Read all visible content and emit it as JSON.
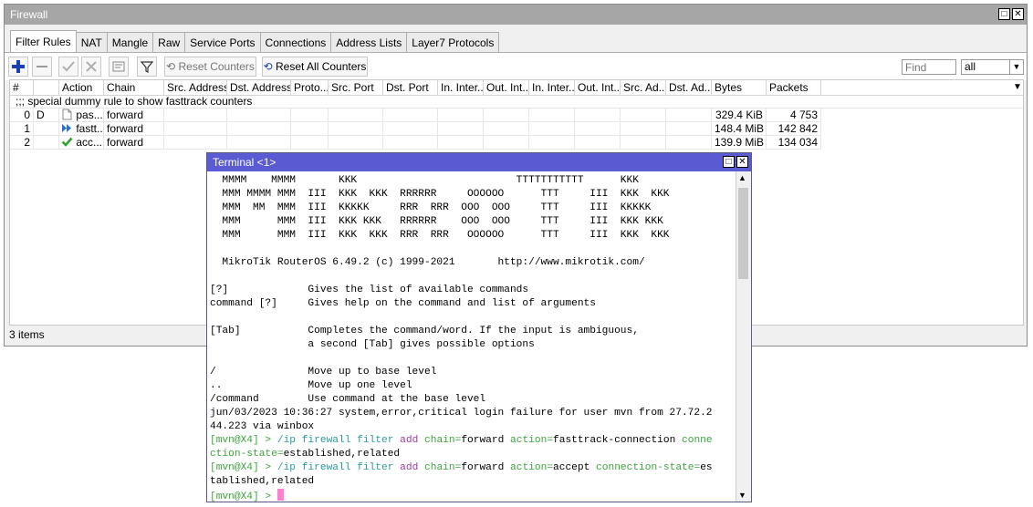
{
  "window": {
    "title": "Firewall"
  },
  "tabs": [
    "Filter Rules",
    "NAT",
    "Mangle",
    "Raw",
    "Service Ports",
    "Connections",
    "Address Lists",
    "Layer7 Protocols"
  ],
  "toolbar": {
    "reset_counters": "Reset Counters",
    "reset_all_counters": "Reset All Counters",
    "find_placeholder": "Find",
    "filter_value": "all"
  },
  "table": {
    "columns": [
      "#",
      "Action",
      "Chain",
      "Src. Address",
      "Dst. Address",
      "Proto...",
      "Src. Port",
      "Dst. Port",
      "In. Inter...",
      "Out. Int...",
      "In. Inter...",
      "Out. Int...",
      "Src. Ad...",
      "Dst. Ad...",
      "Bytes",
      "Packets"
    ],
    "comment": ";;; special dummy rule to show fasttrack counters",
    "rows": [
      {
        "num": "0",
        "flag": "D",
        "action": "pas...",
        "chain": "forward",
        "bytes": "329.4 KiB",
        "packets": "4 753",
        "icon": "passthrough-icon"
      },
      {
        "num": "1",
        "flag": "",
        "action": "fastt...",
        "chain": "forward",
        "bytes": "148.4 MiB",
        "packets": "142 842",
        "icon": "fasttrack-icon"
      },
      {
        "num": "2",
        "flag": "",
        "action": "acc...",
        "chain": "forward",
        "bytes": "139.9 MiB",
        "packets": "134 034",
        "icon": "accept-icon"
      }
    ]
  },
  "status": "3 items",
  "terminal": {
    "title": "Terminal <1>",
    "lines": [
      "  MMMM    MMMM       KKK                          TTTTTTTTTTT      KKK",
      "  MMM MMMM MMM  III  KKK  KKK  RRRRRR     OOOOOO      TTT     III  KKK  KKK",
      "  MMM  MM  MMM  III  KKKKK     RRR  RRR  OOO  OOO     TTT     III  KKKKK",
      "  MMM      MMM  III  KKK KKK   RRRRRR    OOO  OOO     TTT     III  KKK KKK",
      "  MMM      MMM  III  KKK  KKK  RRR  RRR   OOOOOO      TTT     III  KKK  KKK",
      "",
      "  MikroTik RouterOS 6.49.2 (c) 1999-2021       http://www.mikrotik.com/",
      "",
      "[?]             Gives the list of available commands",
      "command [?]     Gives help on the command and list of arguments",
      "",
      "[Tab]           Completes the command/word. If the input is ambiguous,",
      "                a second [Tab] gives possible options",
      "",
      "/               Move up to base level",
      "..              Move up one level",
      "/command        Use command at the base level",
      "jun/03/2023 10:36:27 system,error,critical login failure for user mvn from 27.72.2",
      "44.223 via winbox"
    ],
    "prompt": "[mvn@X4] >",
    "cmd1": {
      "path": "/ip firewall filter",
      "verb": "add",
      "p1k": "chain=",
      "p1v": "forward",
      "p2k": "action=",
      "p2v": "fasttrack-connection",
      "p3k_a": "conne",
      "p3k_b": "ction-state=",
      "p3v": "established,related"
    },
    "cmd2": {
      "path": "/ip firewall filter",
      "verb": "add",
      "p1k": "chain=",
      "p1v": "forward",
      "p2k": "action=",
      "p2v": "accept",
      "p3k": "connection-state=",
      "p3v_a": "es",
      "p3v_b": "tablished,related"
    }
  }
}
